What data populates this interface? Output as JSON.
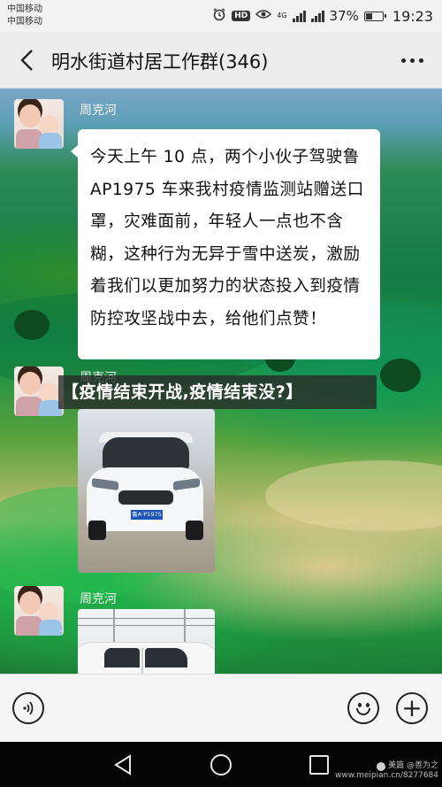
{
  "status_bar": {
    "carrier_1": "中国移动",
    "carrier_2": "中国移动",
    "icons": [
      "alarm-icon",
      "hd-icon",
      "eye-icon",
      "signal-4g-icon",
      "signal-icon"
    ],
    "hd_label": "HD",
    "network_label": "4G",
    "battery_percent": "37%",
    "battery_level": 0.37,
    "time": "19:23"
  },
  "header": {
    "title": "明水街道村居工作群(346)"
  },
  "messages": [
    {
      "sender": "周克河",
      "type": "text",
      "text": "今天上午 10 点，两个小伙子驾驶鲁 AP1975 车来我村疫情监测站赠送口罩，灾难面前，年轻人一点也不含糊，这种行为无异于雪中送炭，激励着我们以更加努力的状态投入到疫情防控攻坚战中去，给他们点赞！"
    },
    {
      "sender": "周克河",
      "type": "image",
      "image_desc_icon": "car-photo-icon",
      "plate": "鲁A·P1975"
    },
    {
      "sender": "周克河",
      "type": "image",
      "image_desc_icon": "car-photo-icon"
    }
  ],
  "overlay_banner": "【疫情结束开战,疫情结束没?】",
  "input_bar": {
    "left_icon": "voice-icon",
    "emoji_icon": "emoji-icon",
    "plus_icon": "plus-icon",
    "plus_glyph": "+"
  },
  "nav_bar": {
    "icons": [
      "nav-back-icon",
      "nav-home-icon",
      "nav-recent-icon"
    ]
  },
  "watermark": {
    "line_1": "美篇 @善为之",
    "line_2": "www.meipian.cn/8277684"
  }
}
